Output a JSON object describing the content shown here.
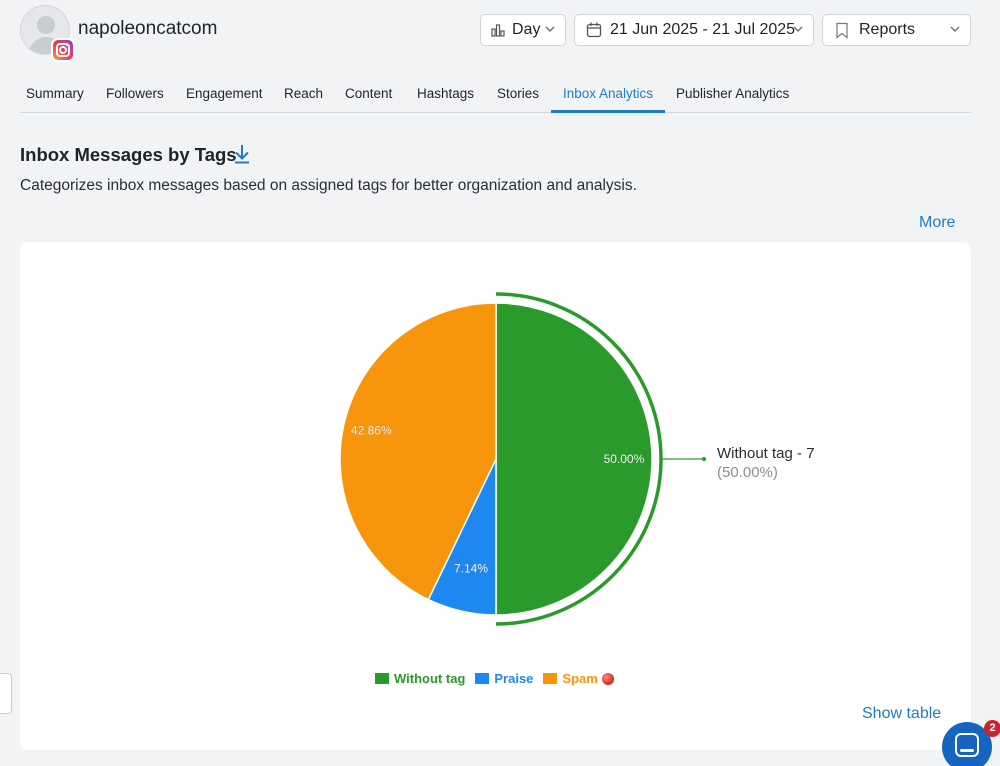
{
  "account": {
    "name": "napoleoncatcom",
    "network_icon": "instagram-icon"
  },
  "controls": {
    "granularity": "Day",
    "date_range": "21 Jun 2025 - 21 Jul 2025",
    "reports": "Reports"
  },
  "tabs": [
    {
      "label": "Summary"
    },
    {
      "label": "Followers"
    },
    {
      "label": "Engagement"
    },
    {
      "label": "Reach"
    },
    {
      "label": "Content"
    },
    {
      "label": "Hashtags"
    },
    {
      "label": "Stories"
    },
    {
      "label": "Inbox Analytics",
      "active": true
    },
    {
      "label": "Publisher Analytics"
    }
  ],
  "section": {
    "title": "Inbox Messages by Tags",
    "description": "Categorizes inbox messages based on assigned tags for better organization and analysis.",
    "more_label": "More",
    "show_table_label": "Show table"
  },
  "chart_data": {
    "type": "pie",
    "slices": [
      {
        "name": "Without tag",
        "percent": 50.0,
        "label": "50.00%",
        "color": "#2a9b2a"
      },
      {
        "name": "Praise",
        "percent": 7.14,
        "label": "7.14%",
        "color": "#1e88f0"
      },
      {
        "name": "Spam",
        "percent": 42.86,
        "label": "42.86%",
        "color": "#f7960c"
      }
    ],
    "highlighted_slice": "Without tag",
    "tooltip": {
      "line1": "Without tag - 7",
      "line2": "(50.00%)"
    },
    "legend_placement": "bottom"
  },
  "chat": {
    "badge_count": "2"
  },
  "colors": {
    "accent": "#1a7fc4",
    "badge": "#d0212c"
  }
}
